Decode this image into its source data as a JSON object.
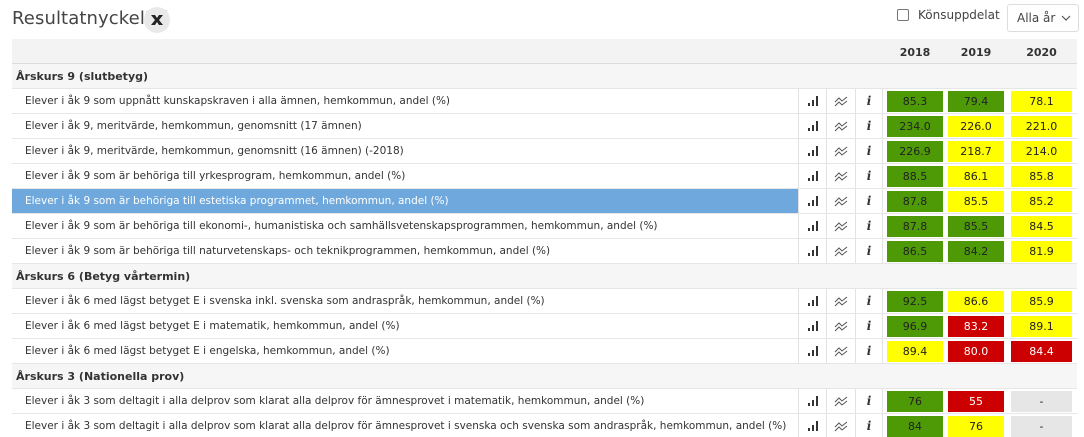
{
  "page": {
    "title": "Resultatnyckeltal",
    "export_icon": "excel-icon"
  },
  "controls": {
    "gender_split_label": "Könsuppdelat",
    "gender_split_checked": false,
    "year_select_value": "Alla år"
  },
  "colors": {
    "green": "#4e9a06",
    "yellow": "#ffff00",
    "red": "#cc0000",
    "gray": "#e6e6e6",
    "selected": "#6fa8dc"
  },
  "table": {
    "years": [
      "2018",
      "2019",
      "2020"
    ],
    "icons": [
      "bar-chart-icon",
      "trend-line-icon",
      "info-icon"
    ],
    "info_glyph": "i",
    "sections": [
      {
        "label": "Årskurs 9 (slutbetyg)",
        "rows": [
          {
            "label": "Elever i åk 9 som uppnått kunskapskraven i alla ämnen, hemkommun, andel (%)",
            "values": [
              "85.3",
              "79.4",
              "78.1"
            ],
            "status": [
              "green",
              "green",
              "yellow"
            ]
          },
          {
            "label": "Elever i åk 9, meritvärde, hemkommun, genomsnitt (17 ämnen)",
            "values": [
              "234.0",
              "226.0",
              "221.0"
            ],
            "status": [
              "green",
              "yellow",
              "yellow"
            ]
          },
          {
            "label": "Elever i åk 9, meritvärde, hemkommun, genomsnitt (16 ämnen) (-2018)",
            "values": [
              "226.9",
              "218.7",
              "214.0"
            ],
            "status": [
              "green",
              "yellow",
              "yellow"
            ]
          },
          {
            "label": "Elever i åk 9 som är behöriga till yrkesprogram, hemkommun, andel (%)",
            "values": [
              "88.5",
              "86.1",
              "85.8"
            ],
            "status": [
              "green",
              "yellow",
              "yellow"
            ]
          },
          {
            "label": "Elever i åk 9 som är behöriga till estetiska programmet, hemkommun, andel (%)",
            "values": [
              "87.8",
              "85.5",
              "85.2"
            ],
            "status": [
              "green",
              "yellow",
              "yellow"
            ],
            "selected": true
          },
          {
            "label": "Elever i åk 9 som är behöriga till ekonomi-, humanistiska och samhällsvetenskapsprogrammen, hemkommun, andel (%)",
            "values": [
              "87.8",
              "85.5",
              "84.5"
            ],
            "status": [
              "green",
              "green",
              "yellow"
            ]
          },
          {
            "label": "Elever i åk 9 som är behöriga till naturvetenskaps- och teknikprogrammen, hemkommun, andel (%)",
            "values": [
              "86.5",
              "84.2",
              "81.9"
            ],
            "status": [
              "green",
              "green",
              "yellow"
            ]
          }
        ]
      },
      {
        "label": "Årskurs 6 (Betyg vårtermin)",
        "rows": [
          {
            "label": "Elever i åk 6 med lägst betyget E i svenska inkl. svenska som andraspråk, hemkommun, andel (%)",
            "values": [
              "92.5",
              "86.6",
              "85.9"
            ],
            "status": [
              "green",
              "yellow",
              "yellow"
            ]
          },
          {
            "label": "Elever i åk 6 med lägst betyget E i matematik, hemkommun, andel (%)",
            "values": [
              "96.9",
              "83.2",
              "89.1"
            ],
            "status": [
              "green",
              "red",
              "yellow"
            ]
          },
          {
            "label": "Elever i åk 6 med lägst betyget E i engelska, hemkommun, andel (%)",
            "values": [
              "89.4",
              "80.0",
              "84.4"
            ],
            "status": [
              "yellow",
              "red",
              "red"
            ]
          }
        ]
      },
      {
        "label": "Årskurs 3 (Nationella prov)",
        "rows": [
          {
            "label": "Elever i åk 3 som deltagit i alla delprov som klarat alla delprov för ämnesprovet i matematik, hemkommun, andel (%)",
            "values": [
              "76",
              "55",
              "-"
            ],
            "status": [
              "green",
              "red",
              "gray"
            ]
          },
          {
            "label": "Elever i åk 3 som deltagit i alla delprov som klarat alla delprov för ämnesprovet i svenska och svenska som andraspråk, hemkommun, andel (%)",
            "values": [
              "84",
              "76",
              "-"
            ],
            "status": [
              "green",
              "yellow",
              "gray"
            ]
          }
        ]
      }
    ]
  }
}
